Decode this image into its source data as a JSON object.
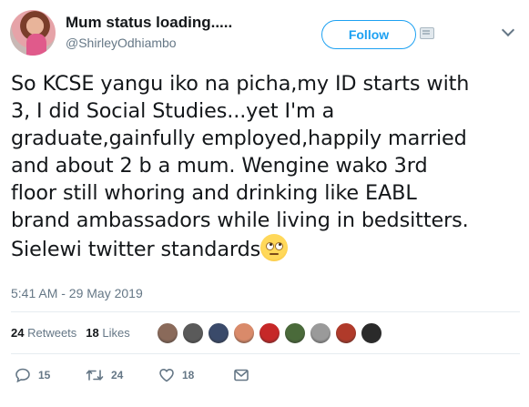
{
  "user": {
    "display_name": "Mum status loading.....",
    "handle": "@ShirleyOdhiambo"
  },
  "header": {
    "follow_label": "Follow"
  },
  "tweet": {
    "lines": [
      "So KCSE yangu iko na picha,my ID starts with",
      "3, I did Social Studies...yet I'm a",
      "graduate,gainfully employed,happily married",
      "and about 2 b a mum. Wengine wako 3rd",
      "floor still whoring and drinking like EABL",
      "brand ambassadors while living in bedsitters.",
      "Sielewi twitter standards"
    ],
    "emoji": "face-with-rolling-eyes",
    "timestamp": "5:41 AM - 29 May 2019"
  },
  "stats": {
    "retweets_count": "24",
    "retweets_label": "Retweets",
    "likes_count": "18",
    "likes_label": "Likes",
    "liker_avatar_colors": [
      "#8a6a5a",
      "#5a5a5a",
      "#3a4a6a",
      "#d98a6a",
      "#c62828",
      "#4a6a3a",
      "#9a9a9a",
      "#b03a2a",
      "#2a2a2a"
    ]
  },
  "actions": {
    "reply_count": "15",
    "retweet_count": "24",
    "like_count": "18"
  },
  "colors": {
    "accent": "#1da1f2",
    "secondary_text": "#657786",
    "divider": "#e6ecf0"
  }
}
